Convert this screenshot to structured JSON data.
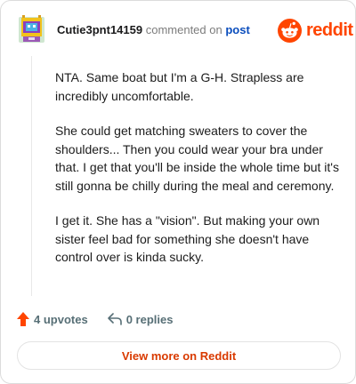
{
  "header": {
    "username": "Cutie3pnt14159",
    "commented_text": "commented on",
    "post_link": "post",
    "brand": "reddit"
  },
  "comment": {
    "paragraphs": [
      "NTA. Same boat but I'm a G-H. Strapless are incredibly uncomfortable.",
      "She could get matching sweaters to cover the shoulders... Then you could wear your bra under that. I get that you'll be inside the whole time but it's still gonna be chilly during the meal and ceremony.",
      "I get it. She has a \"vision\". But making your own sister feel bad for something she doesn't have control over is kinda sucky."
    ]
  },
  "actions": {
    "upvotes": "4 upvotes",
    "replies": "0 replies"
  },
  "footer": {
    "view_more": "View more on Reddit"
  },
  "colors": {
    "brand": "#ff4500",
    "upvote_icon": "#ff4500",
    "view_more_text": "#d93a00",
    "post_link": "#0a4dbd"
  },
  "icons": {
    "avatar": "pixel-avatar",
    "logo": "reddit-snoo-icon",
    "upvote": "upvote-arrow-icon",
    "reply": "reply-arrow-icon"
  }
}
